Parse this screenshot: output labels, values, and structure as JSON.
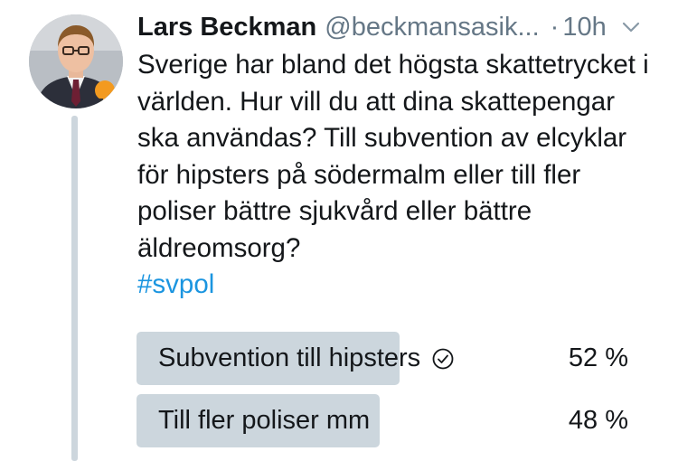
{
  "tweet": {
    "author_name": "Lars Beckman",
    "handle": "@beckmansasik...",
    "separator": "·",
    "time": "10h",
    "menu_icon": "chevron-down-icon",
    "text": "Sverige har bland det högsta skattetrycket i världen. Hur vill du att dina skattepengar ska användas? Till subvention av elcyklar för hipsters på södermalm eller till fler poliser bättre sjukvård eller bättre äldreomsorg?",
    "hashtag": "#svpol"
  },
  "poll": {
    "options": [
      {
        "label": "Subvention till hipsters",
        "percent_text": "52 %",
        "share": 0.52,
        "winner": true
      },
      {
        "label": "Till fler poliser mm",
        "percent_text": "48 %",
        "share": 0.48,
        "winner": false
      }
    ]
  },
  "colors": {
    "hashtag": "#1b95e0",
    "poll_bar": "#ccd6dd",
    "muted_text": "#657786"
  }
}
